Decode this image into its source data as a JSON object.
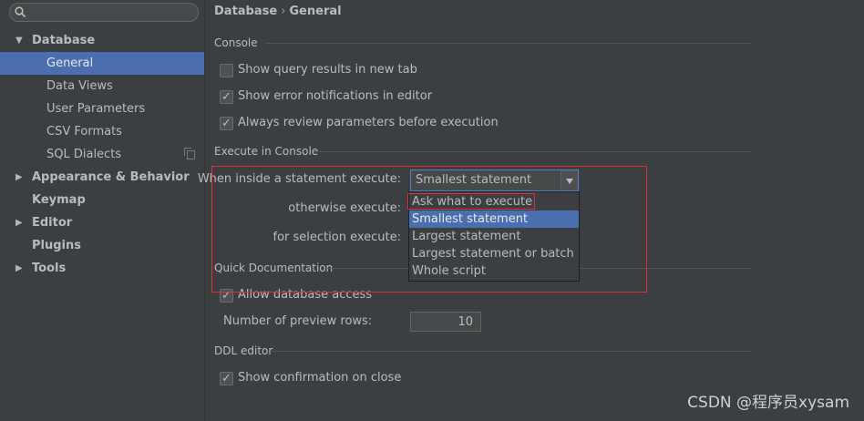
{
  "sidebar": {
    "search_value": "",
    "items": [
      {
        "label": "Database",
        "arrow": "▼"
      },
      {
        "label": "General"
      },
      {
        "label": "Data Views"
      },
      {
        "label": "User Parameters"
      },
      {
        "label": "CSV Formats"
      },
      {
        "label": "SQL Dialects"
      },
      {
        "label": "Appearance & Behavior",
        "arrow": "▶"
      },
      {
        "label": "Keymap"
      },
      {
        "label": "Editor",
        "arrow": "▶"
      },
      {
        "label": "Plugins"
      },
      {
        "label": "Tools",
        "arrow": "▶"
      }
    ]
  },
  "breadcrumb": {
    "part1": "Database",
    "sep": "›",
    "part2": "General"
  },
  "console": {
    "title": "Console",
    "show_results": "Show query results in new tab",
    "show_errors": "Show error notifications in editor",
    "review_params": "Always review parameters before execution"
  },
  "execute": {
    "title": "Execute in Console",
    "inside_label": "When inside a statement execute:",
    "inside_value": "Smallest statement",
    "otherwise_label": "otherwise execute:",
    "selection_label": "for selection execute:",
    "options": [
      "Ask what to execute",
      "Smallest statement",
      "Largest statement",
      "Largest statement or batch",
      "Whole script"
    ]
  },
  "quickdoc": {
    "title": "Quick Documentation",
    "allow_db": "Allow database access",
    "preview_rows_label": "Number of preview rows:",
    "preview_rows_value": "10"
  },
  "ddl": {
    "title": "DDL editor",
    "confirm_close": "Show confirmation on close"
  },
  "watermark": "CSDN @程序员xysam",
  "colors": {
    "selection": "#4b6eaf",
    "highlight": "#e03030",
    "background": "#3c3f41"
  }
}
